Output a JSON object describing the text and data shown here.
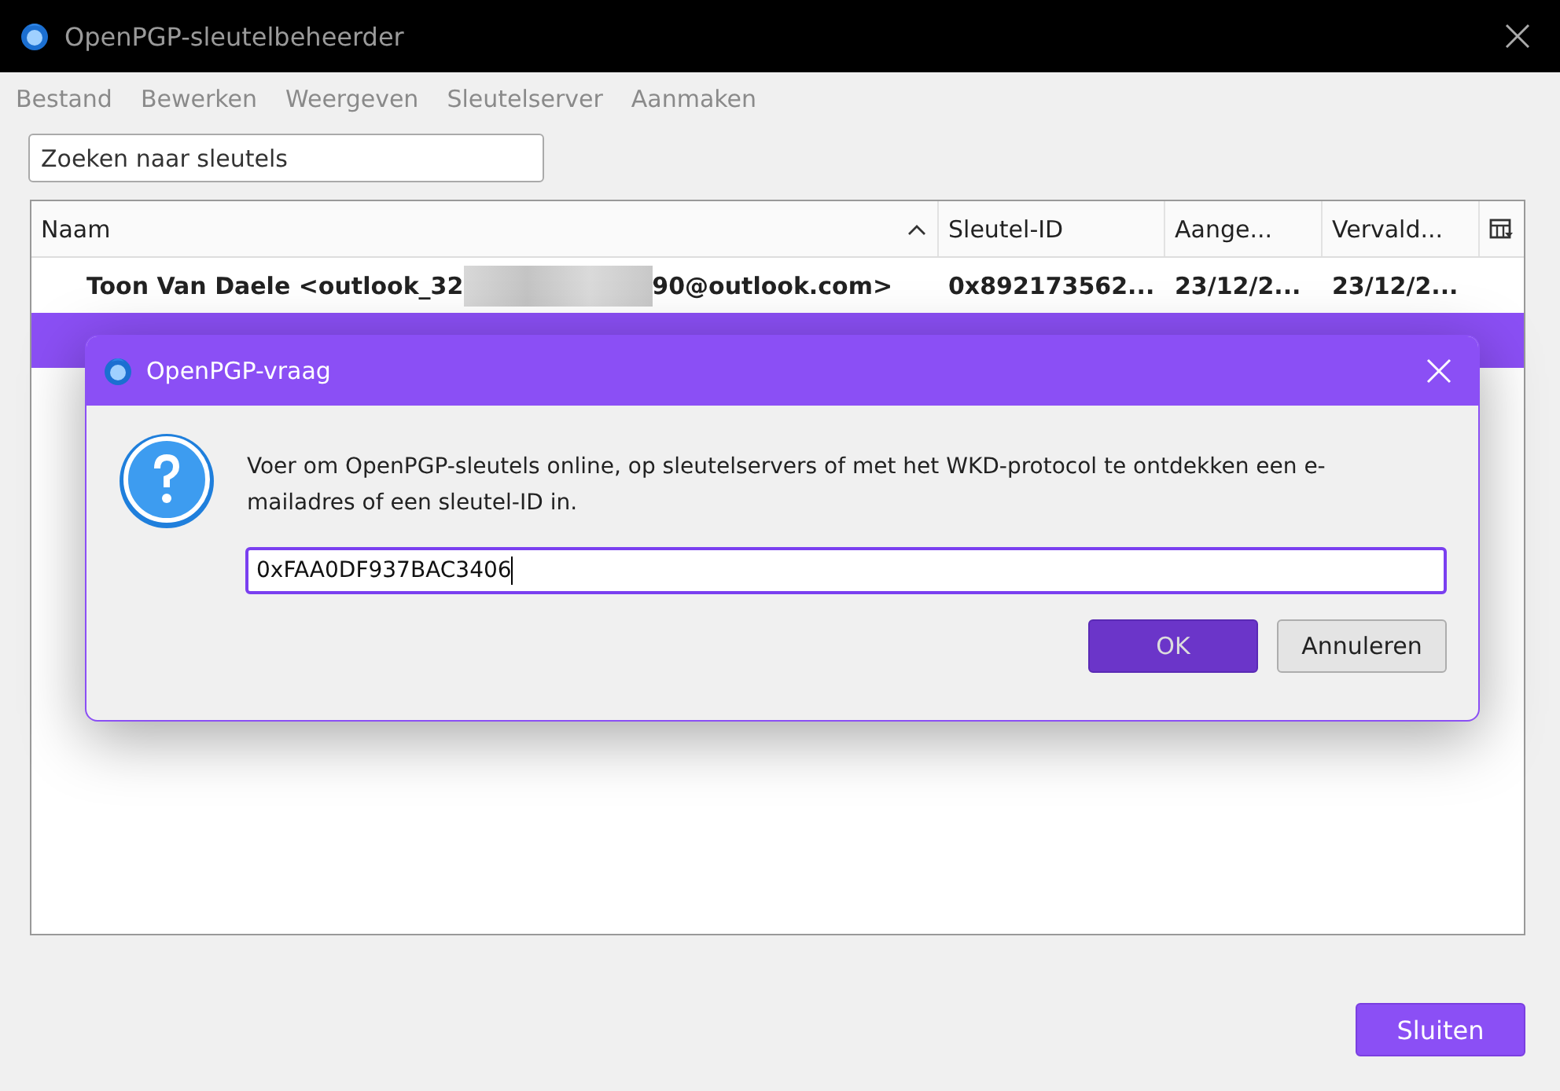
{
  "window": {
    "title": "OpenPGP-sleutelbeheerder"
  },
  "menu": [
    {
      "label": "Bestand"
    },
    {
      "label": "Bewerken"
    },
    {
      "label": "Weergeven"
    },
    {
      "label": "Sleutelserver"
    },
    {
      "label": "Aanmaken"
    }
  ],
  "search": {
    "placeholder": "Zoeken naar sleutels"
  },
  "table": {
    "columns": [
      {
        "label": "Naam",
        "sorted": true
      },
      {
        "label": "Sleutel-ID",
        "sorted": false
      },
      {
        "label": "Aange...",
        "sorted": false
      },
      {
        "label": "Vervald...",
        "sorted": false
      }
    ],
    "rows": [
      {
        "selected": false,
        "name_start": "Toon Van Daele <outlook_32",
        "redacted": true,
        "name_end": "90@outlook.com>",
        "key_id": "0x892173562...",
        "created": "23/12/2...",
        "expires": "23/12/2..."
      },
      {
        "selected": true
      }
    ]
  },
  "dialog": {
    "title": "OpenPGP-vraag",
    "message": "Voer om OpenPGP-sleutels online, op sleutelservers of met het WKD-protocol te ontdekken een e-mailadres of een sleutel-ID in.",
    "input": {
      "value": "0xFAA0DF937BAC3406",
      "focused": true
    },
    "buttons": [
      {
        "label": "OK",
        "kind": "primary"
      },
      {
        "label": "Annuleren",
        "kind": "secondary"
      }
    ]
  },
  "footer": {
    "buttons": [
      {
        "label": "Sluiten",
        "kind": "primary"
      }
    ]
  }
}
